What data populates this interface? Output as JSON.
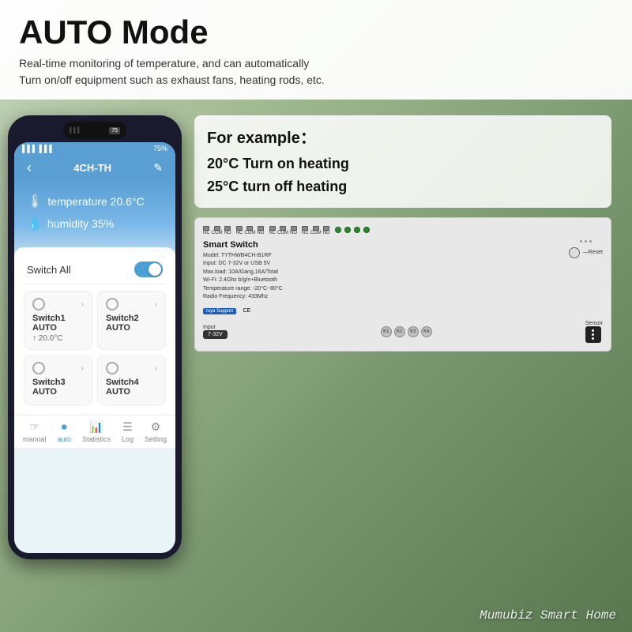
{
  "page": {
    "background_color": "#c8d8c0"
  },
  "top_section": {
    "title": "AUTO Mode",
    "description_line1": "Real-time monitoring of temperature, and can automatically",
    "description_line2": "Turn on/off equipment such as exhaust fans, heating rods, etc."
  },
  "phone": {
    "header_title": "4CH-TH",
    "status_bar_signal": "📶📶 75",
    "back_icon": "‹",
    "edit_icon": "✎",
    "temperature_label": "temperature 20.6°C",
    "humidity_label": "humidity 35%",
    "switch_all_label": "Switch All",
    "toggle_state": "on",
    "switches": [
      {
        "name": "Switch1 AUTO",
        "temp": "↑ 20.0°C"
      },
      {
        "name": "Switch2 AUTO",
        "temp": ""
      },
      {
        "name": "Switch3 AUTO",
        "temp": ""
      },
      {
        "name": "Switch4 AUTO",
        "temp": ""
      }
    ],
    "nav_items": [
      {
        "label": "manual",
        "icon": "☞",
        "active": false
      },
      {
        "label": "auto",
        "icon": "⏺",
        "active": true
      },
      {
        "label": "Statistics",
        "icon": "📊",
        "active": false
      },
      {
        "label": "Log",
        "icon": "☰",
        "active": false
      },
      {
        "label": "Setting",
        "icon": "⚙",
        "active": false
      }
    ]
  },
  "example_section": {
    "title": "For example：",
    "line1": "20°C   Turn on heating",
    "line2": "25°C   turn off  heating"
  },
  "device": {
    "title": "Smart  Switch",
    "model": "Model:  TYTHWB4CH-B1RF",
    "input": "Input:  DC 7-32V or USB 5V",
    "max_load": "Max.load: 10A/Gang,16A/Total",
    "wifi": "Wi-Fi: 2.4Ghz b/g/n+Bluetooth",
    "temp_range": "Temperature range: -20°C~80°C",
    "radio": "Radio Frequency: 433Mhz",
    "tuya_label": "tuya Support",
    "reset_label": "—Reset",
    "input_label": "Input",
    "input_voltage": "7-32V",
    "k_labels": [
      "K1",
      "K2",
      "K3",
      "K4"
    ],
    "sensor_label": "Sensor",
    "connector_groups": [
      [
        "NC",
        "COM",
        "NO"
      ],
      [
        "NC",
        "COM",
        "NO"
      ],
      [
        "NC",
        "COM",
        "NO"
      ],
      [
        "NC",
        "COM",
        "NO"
      ]
    ]
  },
  "branding": {
    "text": "Mumubiz Smart Home"
  }
}
